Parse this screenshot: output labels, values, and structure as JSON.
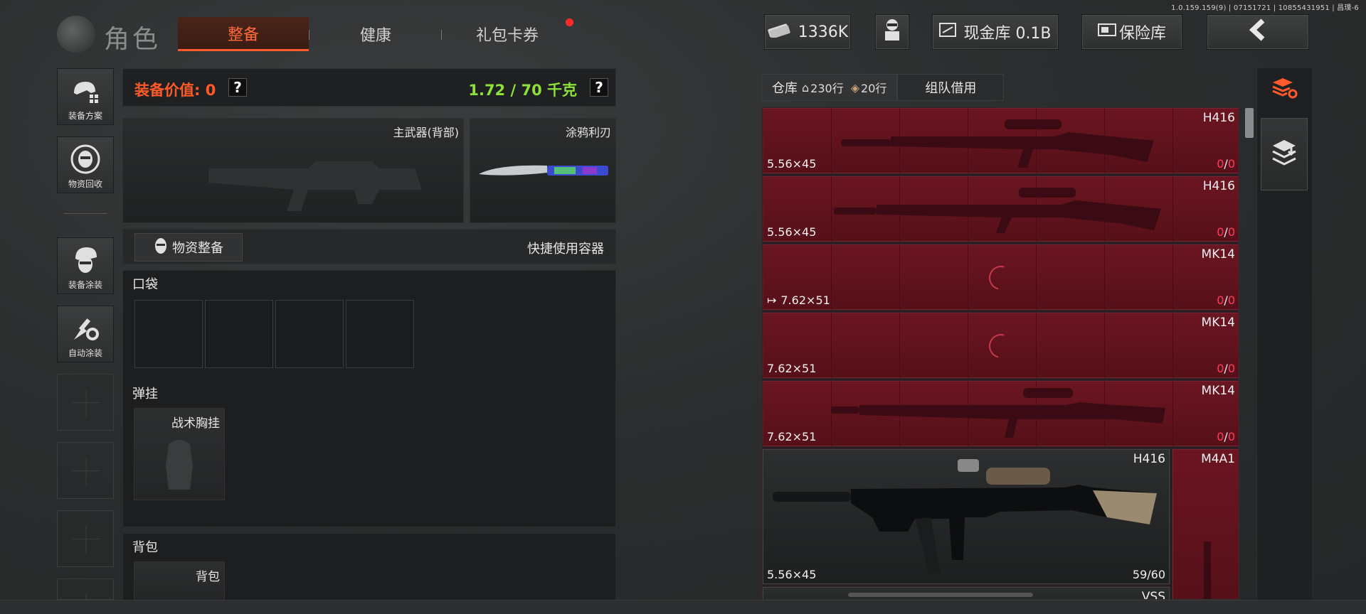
{
  "version": "1.0.159.159(9) | 07151721 | 10855431951 | 昌璞-6",
  "header": {
    "title": "角色",
    "tabs": [
      {
        "label": "整备",
        "active": true
      },
      {
        "label": "健康",
        "active": false
      },
      {
        "label": "礼包卡券",
        "active": false,
        "notification": true
      }
    ],
    "money": "1336K",
    "cash_vault": "现金库 0.1B",
    "safe": "保险库"
  },
  "nav": {
    "items": [
      {
        "label": "装备方案",
        "icon": "helmet-grid-icon"
      },
      {
        "label": "物资回收",
        "icon": "recycle-face-icon"
      },
      {
        "label": "装备涂装",
        "icon": "helmet-paint-icon"
      },
      {
        "label": "自动涂装",
        "icon": "brush-gear-icon"
      }
    ]
  },
  "equip": {
    "value_label": "装备价值: 0",
    "weight_label": "1.72 / 70 千克",
    "primary_weapon_label": "主武器(背部)",
    "knife_label": "涂鸦利刃",
    "supply_button": "物资整备",
    "quick_container": "快捷使用容器",
    "pocket_title": "口袋",
    "vest_title": "弹挂",
    "vest_slot_label": "战术胸挂",
    "backpack_title": "背包",
    "backpack_slot_label": "背包"
  },
  "warehouse": {
    "tab_label": "仓库",
    "rows_home": "230行",
    "rows_bag": "20行",
    "team_tab": "组队借用",
    "items": [
      {
        "name": "H416",
        "ammo": "5.56×45",
        "count_a": "0",
        "count_b": "0"
      },
      {
        "name": "H416",
        "ammo": "5.56×45",
        "count_a": "0",
        "count_b": "0"
      },
      {
        "name": "MK14",
        "ammo": "7.62×51",
        "count_a": "0",
        "count_b": "0",
        "leading_icon": "exit-arrow-icon"
      },
      {
        "name": "MK14",
        "ammo": "7.62×51",
        "count_a": "0",
        "count_b": "0"
      },
      {
        "name": "MK14",
        "ammo": "7.62×51",
        "count_a": "0",
        "count_b": "0"
      },
      {
        "name": "H416",
        "ammo": "5.56×45",
        "count": "59/60"
      },
      {
        "name": "M4A1"
      },
      {
        "name": "VSS"
      }
    ]
  },
  "colors": {
    "accent": "#ff5a2a",
    "weight": "#8ee03a",
    "item_red": "#5f1220",
    "zero_count": "#ff3a5a"
  }
}
